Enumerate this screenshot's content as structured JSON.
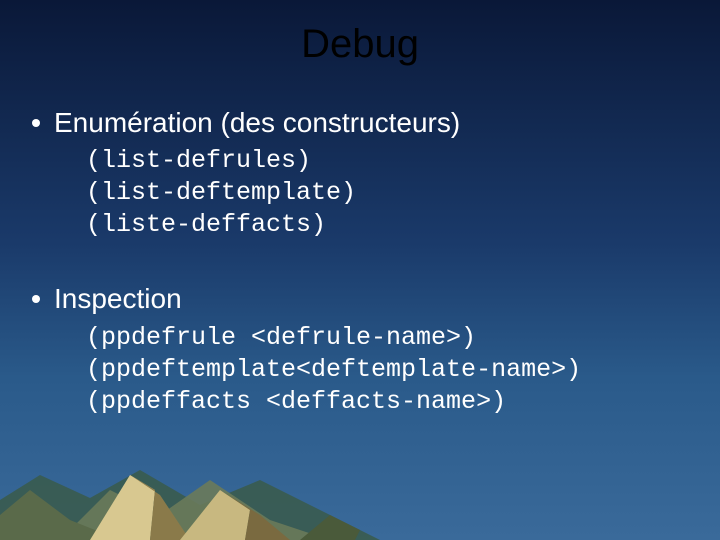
{
  "title": "Debug",
  "section1": {
    "heading": "Enumération (des constructeurs)",
    "code1": "(list-defrules)",
    "code2": "(list-deftemplate)",
    "code3": "(liste-deffacts)"
  },
  "section2": {
    "heading": "Inspection",
    "code1": "(ppdefrule <defrule-name>)",
    "code2": "(ppdeftemplate<deftemplate-name>)",
    "code3": "(ppdeffacts <deffacts-name>)"
  }
}
